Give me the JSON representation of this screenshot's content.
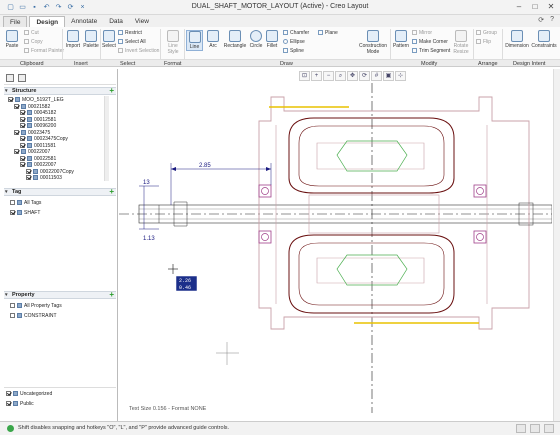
{
  "window": {
    "title": "DUAL_SHAFT_MOTOR_LAYOUT (Active) - Creo Layout",
    "quick_access": [
      "new-icon",
      "open-icon",
      "save-icon",
      "undo-icon",
      "redo-icon",
      "regenerate-icon",
      "close-window-icon"
    ],
    "controls": [
      "minimize",
      "maximize",
      "close"
    ]
  },
  "tabs": [
    {
      "label": "File",
      "type": "file"
    },
    {
      "label": "Design",
      "active": true
    },
    {
      "label": "Annotate"
    },
    {
      "label": "Data"
    },
    {
      "label": "View"
    }
  ],
  "ribbon": {
    "clipboard": {
      "paste": "Paste",
      "cut": "Cut",
      "copy": "Copy",
      "format_painter": "Format Painter"
    },
    "insert": {
      "import": "Import",
      "palette": "Palette"
    },
    "select": {
      "select": "Select",
      "restrict": "Restrict",
      "select_all": "Select All",
      "invert": "Invert Selection"
    },
    "format": {
      "line_style": "Line Style"
    },
    "draw": {
      "line": "Line",
      "arc": "Arc",
      "rectangle": "Rectangle",
      "circle": "Circle",
      "fillet": "Fillet",
      "chamfer": "Chamfer",
      "ellipse": "Ellipse",
      "spline": "Spline",
      "plane": "Plane",
      "construction_mode": "Construction Mode"
    },
    "modify": {
      "pattern": "Pattern",
      "mirror": "Mirror",
      "make_corner": "Make Corner",
      "trim_segment": "Trim Segment",
      "rotate_resize": "Rotate Resize"
    },
    "arrange": {
      "group": "Group",
      "flip": "Flip"
    },
    "intent": {
      "dimension": "Dimension",
      "constraints": "Constraints"
    }
  },
  "groups": [
    "Clipboard",
    "Insert",
    "Select",
    "Format",
    "Draw",
    "Modify",
    "Arrange",
    "Design Intent"
  ],
  "panel": {
    "structure_title": "Structure",
    "structure_items": [
      {
        "label": "MOO_5192T_LEG",
        "level": 0,
        "checked": true
      },
      {
        "label": "00021582",
        "level": 1,
        "checked": true
      },
      {
        "label": "00045182",
        "level": 2,
        "checked": true
      },
      {
        "label": "00012581",
        "level": 2,
        "checked": true
      },
      {
        "label": "00096200",
        "level": 2,
        "checked": true
      },
      {
        "label": "00023475",
        "level": 1,
        "checked": true
      },
      {
        "label": "00023475Copy",
        "level": 2,
        "checked": true
      },
      {
        "label": "00011581",
        "level": 2,
        "checked": true
      },
      {
        "label": "00022007",
        "level": 1,
        "checked": true
      },
      {
        "label": "00022581",
        "level": 2,
        "checked": true
      },
      {
        "label": "00022007",
        "level": 2,
        "checked": true
      },
      {
        "label": "00022007Copy",
        "level": 3,
        "checked": true
      },
      {
        "label": "00011503",
        "level": 3,
        "checked": true
      }
    ],
    "tag_title": "Tag",
    "tag_items": [
      {
        "label": "All Tags",
        "checked": false
      },
      {
        "label": "SHAFT",
        "checked": true
      }
    ],
    "property_title": "Property",
    "property_items": [
      {
        "label": "All Property Tags",
        "checked": false
      },
      {
        "label": "CONSTRAINT",
        "checked": false
      }
    ],
    "bottom_items": [
      {
        "label": "Uncategorized",
        "checked": true
      },
      {
        "label": "Public",
        "checked": true
      }
    ]
  },
  "canvas": {
    "dimensions": [
      "2.85",
      "13",
      "1.13"
    ],
    "coord_readout": [
      "2.26",
      "0.46"
    ],
    "text_size_label": "Text Size 0.156 - Format NONE"
  },
  "status": {
    "message": "Shift disables snapping and hotkeys \"O\", \"L\", and \"P\" provide advanced guide controls."
  },
  "colors": {
    "accent": "#2f6db5",
    "canvas_part": "#c8a0a8",
    "canvas_green": "#4caf50",
    "canvas_yellow": "#e8c200",
    "dim_color": "#1a1a80"
  }
}
